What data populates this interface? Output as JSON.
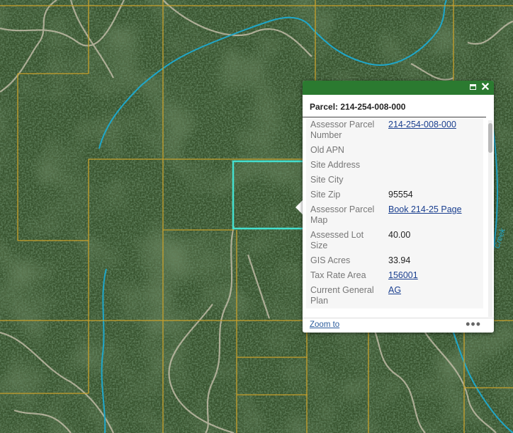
{
  "map": {
    "label_creek": "Creek",
    "colors": {
      "parcel_line": "#c8a02b",
      "stream": "#1fa7c9",
      "selected_parcel": "#44e0cf",
      "road": "#cfc6b3"
    }
  },
  "popup": {
    "title": "Parcel: 214-254-008-000",
    "maximize_icon": "maximize-icon",
    "close_icon": "close-icon",
    "close_glyph": "✕",
    "fields": [
      {
        "label": "Assessor Parcel Number",
        "value": "214-254-008-000",
        "link": true
      },
      {
        "label": "Old APN",
        "value": "",
        "link": false
      },
      {
        "label": "Site Address",
        "value": "",
        "link": false
      },
      {
        "label": "Site City",
        "value": "",
        "link": false
      },
      {
        "label": "Site Zip",
        "value": "95554",
        "link": false
      },
      {
        "label": "Assessor Parcel Map",
        "value": "Book 214-25 Page",
        "link": true
      },
      {
        "label": "Assessed Lot Size",
        "value": "40.00",
        "link": false
      },
      {
        "label": "GIS Acres",
        "value": "33.94",
        "link": false
      },
      {
        "label": "Tax Rate Area",
        "value": "156001",
        "link": true
      },
      {
        "label": "Current General Plan",
        "value": "AG",
        "link": true
      }
    ],
    "footer": {
      "zoom_to": "Zoom to",
      "more": "•••"
    }
  }
}
